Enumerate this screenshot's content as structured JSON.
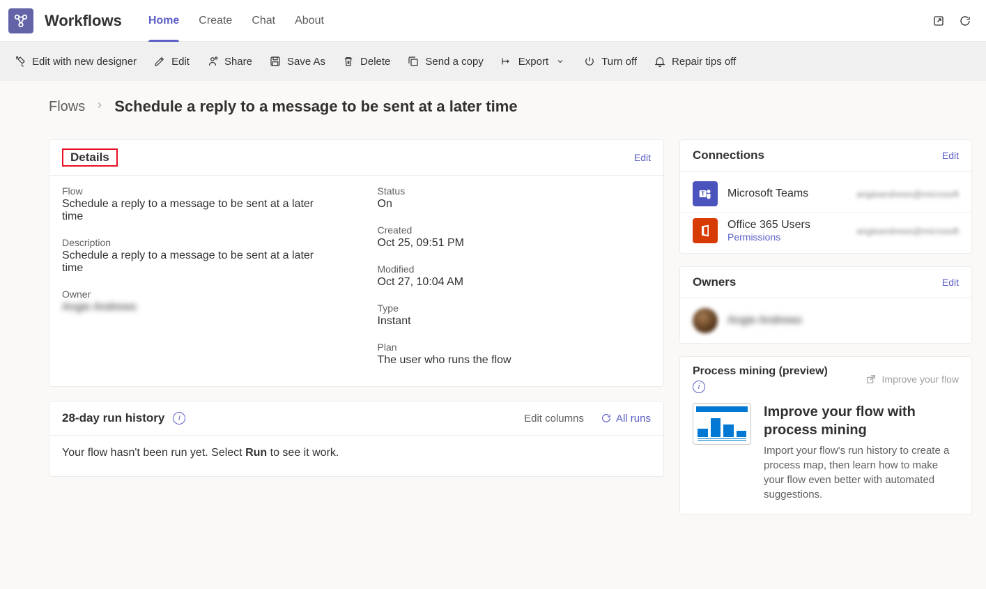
{
  "header": {
    "app_title": "Workflows",
    "tabs": [
      "Home",
      "Create",
      "Chat",
      "About"
    ],
    "active_tab_index": 0
  },
  "commands": {
    "edit_new_designer": "Edit with new designer",
    "edit": "Edit",
    "share": "Share",
    "save_as": "Save As",
    "delete": "Delete",
    "send_copy": "Send a copy",
    "export": "Export",
    "turn_off": "Turn off",
    "repair_tips": "Repair tips off"
  },
  "breadcrumb": {
    "root": "Flows",
    "current": "Schedule a reply to a message to be sent at a later time"
  },
  "details": {
    "title": "Details",
    "edit": "Edit",
    "flow_label": "Flow",
    "flow_value": "Schedule a reply to a message to be sent at a later time",
    "desc_label": "Description",
    "desc_value": "Schedule a reply to a message to be sent at a later time",
    "owner_label": "Owner",
    "owner_value": "Angie Andrews",
    "status_label": "Status",
    "status_value": "On",
    "created_label": "Created",
    "created_value": "Oct 25, 09:51 PM",
    "modified_label": "Modified",
    "modified_value": "Oct 27, 10:04 AM",
    "type_label": "Type",
    "type_value": "Instant",
    "plan_label": "Plan",
    "plan_value": "The user who runs the flow"
  },
  "run_history": {
    "title": "28-day run history",
    "edit_columns": "Edit columns",
    "all_runs": "All runs",
    "empty_pre": "Your flow hasn't been run yet. Select ",
    "empty_bold": "Run",
    "empty_post": " to see it work."
  },
  "connections": {
    "title": "Connections",
    "edit": "Edit",
    "items": [
      {
        "name": "Microsoft Teams",
        "sub": "",
        "account": "angieandrews@microsoft"
      },
      {
        "name": "Office 365 Users",
        "sub": "Permissions",
        "account": "angieandrews@microsoft"
      }
    ]
  },
  "owners": {
    "title": "Owners",
    "edit": "Edit",
    "name": "Angie Andrews"
  },
  "process_mining": {
    "title": "Process mining (preview)",
    "improve_link": "Improve your flow",
    "heading": "Improve your flow with process mining",
    "desc": "Import your flow's run history to create a process map, then learn how to make your flow even better with automated suggestions."
  }
}
